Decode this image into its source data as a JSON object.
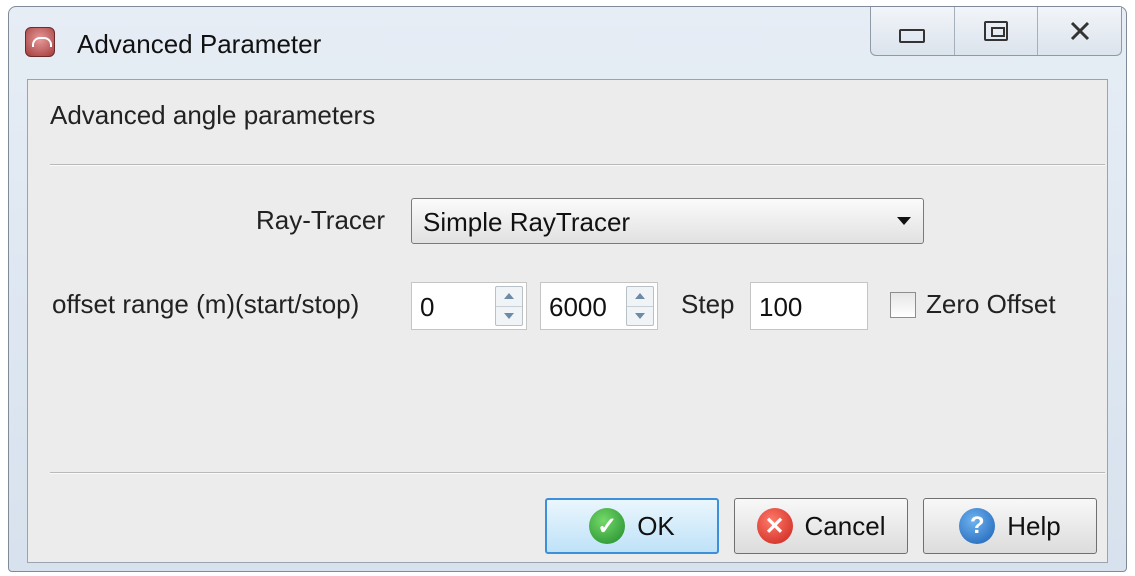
{
  "window": {
    "title": "Advanced Parameter",
    "icon": "app-icon",
    "controls": [
      "minimize-icon",
      "maximize-icon",
      "close-icon"
    ]
  },
  "panel": {
    "section_title": "Advanced angle parameters",
    "raytracer": {
      "label": "Ray-Tracer",
      "selected": "Simple RayTracer"
    },
    "offset": {
      "label": "offset range (m)(start/stop)",
      "start": "0",
      "stop": "6000",
      "step_label": "Step",
      "step": "100",
      "zero_offset_label": "Zero Offset",
      "zero_offset_checked": false
    }
  },
  "buttons": {
    "ok": "OK",
    "cancel": "Cancel",
    "help": "Help"
  },
  "colors": {
    "ok_icon": "#2e9e3a",
    "cancel_icon": "#d9342b",
    "help_icon": "#2a74c9",
    "default_button_border": "#3c8fd8"
  }
}
